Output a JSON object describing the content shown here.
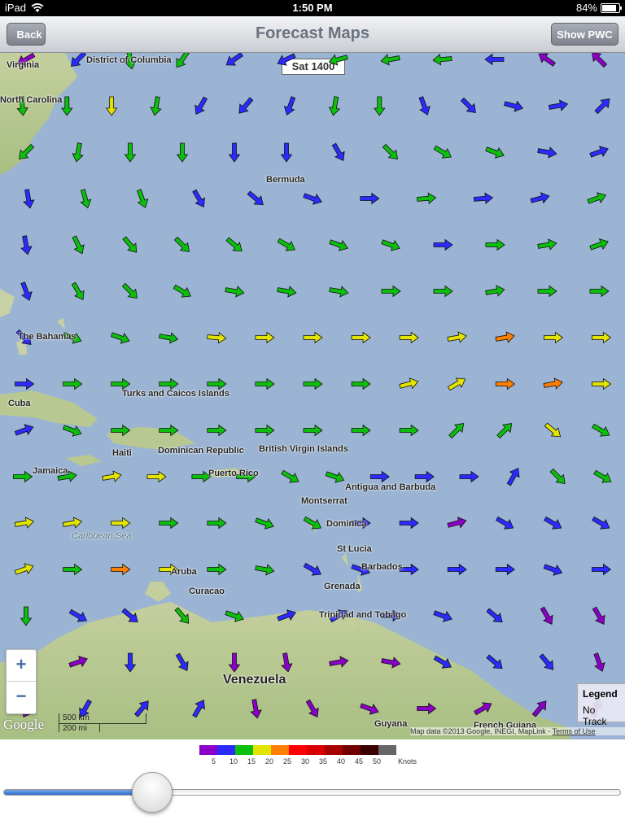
{
  "status_bar": {
    "device": "iPad",
    "time": "1:50 PM",
    "battery": "84%",
    "battery_level": 0.84
  },
  "navbar": {
    "back_label": "Back",
    "title": "Forecast Maps",
    "right_button_label": "Show PWC"
  },
  "map": {
    "time_label": "Sat 1400",
    "places": [
      {
        "id": "virginia",
        "text": "Virginia"
      },
      {
        "id": "dc",
        "text": "District of Columbia"
      },
      {
        "id": "north-carolina",
        "text": "North Carolina"
      },
      {
        "id": "bermuda",
        "text": "Bermuda"
      },
      {
        "id": "bahamas",
        "text": "The Bahamas"
      },
      {
        "id": "cuba",
        "text": "Cuba"
      },
      {
        "id": "turks",
        "text": "Turks and Caicos Islands"
      },
      {
        "id": "haiti",
        "text": "Haiti"
      },
      {
        "id": "dominican",
        "text": "Dominican Republic"
      },
      {
        "id": "bvi",
        "text": "British Virgin Islands"
      },
      {
        "id": "jamaica",
        "text": "Jamaica"
      },
      {
        "id": "puerto-rico",
        "text": "Puerto Rico"
      },
      {
        "id": "antigua",
        "text": "Antigua and Barbuda"
      },
      {
        "id": "montserrat",
        "text": "Montserrat"
      },
      {
        "id": "dominica",
        "text": "Dominica"
      },
      {
        "id": "caribbean",
        "text": "Caribbean Sea"
      },
      {
        "id": "st-lucia",
        "text": "St Lucia"
      },
      {
        "id": "barbados",
        "text": "Barbados"
      },
      {
        "id": "aruba",
        "text": "Aruba"
      },
      {
        "id": "curacao",
        "text": "Curacao"
      },
      {
        "id": "grenada",
        "text": "Grenada"
      },
      {
        "id": "trinidad",
        "text": "Trinidad and Tobago"
      },
      {
        "id": "venezuela",
        "text": "Venezuela"
      },
      {
        "id": "guyana",
        "text": "Guyana"
      },
      {
        "id": "french-guiana",
        "text": "French Guiana"
      }
    ],
    "zoom_in": "+",
    "zoom_out": "−",
    "google_logo": "Google",
    "scale_km": "500 km",
    "scale_mi": "200 mi",
    "copyright": "Map data ©2013 Google, INEGI, MapLink - ",
    "terms_link": "Terms of Use",
    "legend_button": "Legend",
    "track_button": "No Track"
  },
  "wind_colors": {
    "5": "#8a00c8",
    "10": "#2b2bff",
    "15": "#0cbf0c",
    "20": "#e3e300",
    "25": "#ff7f00",
    "30": "#ff0000",
    "35": "#d80000",
    "40": "#a60000",
    "45": "#700000",
    "50": "#3a0000",
    "50+": "#666666"
  },
  "wind_scale": {
    "labels": [
      "5",
      "10",
      "15",
      "20",
      "25",
      "30",
      "35",
      "40",
      "45",
      "50"
    ],
    "unit": "Knots"
  },
  "slider": {
    "value": 0.24
  },
  "wind_grid": [
    [
      "5/150",
      "10/135",
      "15/80",
      "15/125",
      "10/145",
      "10/155",
      "15/165",
      "15/170",
      "15/175",
      "10/180",
      "5/215",
      "5/225"
    ],
    [
      "15/85",
      "15/90",
      "20/90",
      "15/100",
      "10/120",
      "10/130",
      "10/110",
      "15/100",
      "15/90",
      "10/70",
      "10/45",
      "10/15",
      "10/-10",
      "10/-45"
    ],
    [
      "15/135",
      "15/100",
      "15/90",
      "15/90",
      "10/90",
      "10/90",
      "10/60",
      "15/45",
      "15/30",
      "15/20",
      "10/10",
      "10/-20"
    ],
    [
      "10/80",
      "15/75",
      "15/70",
      "10/60",
      "10/40",
      "10/20",
      "10/0",
      "15/-5",
      "10/-5",
      "10/-15",
      "15/-20"
    ],
    [
      "10/80",
      "15/65",
      "15/50",
      "15/45",
      "15/40",
      "15/30",
      "15/20",
      "15/20",
      "10/0",
      "15/0",
      "15/-10",
      "15/-20"
    ],
    [
      "10/70",
      "15/60",
      "15/45",
      "15/30",
      "15/10",
      "15/10",
      "15/10",
      "15/0",
      "15/0",
      "15/-10",
      "15/0",
      "15/0"
    ],
    [
      "10/45",
      "15/20",
      "15/20",
      "15/10",
      "20/5",
      "20/0",
      "20/0",
      "20/0",
      "20/0",
      "20/-10",
      "25/-10",
      "20/0",
      "20/0"
    ],
    [
      "10/0",
      "15/0",
      "15/0",
      "15/0",
      "15/0",
      "15/0",
      "15/0",
      "15/0",
      "20/-15",
      "20/-30",
      "25/0",
      "25/-10",
      "20/0"
    ],
    [
      "10/-20",
      "15/20",
      "15/0",
      "15/0",
      "15/0",
      "15/0",
      "15/0",
      "15/0",
      "15/0",
      "15/-45",
      "15/-45",
      "20/40",
      "15/30"
    ],
    [
      "15/0",
      "15/-10",
      "20/-10",
      "20/0",
      "15/0",
      "15/0",
      "15/30",
      "15/20",
      "10/0",
      "10/0",
      "10/0",
      "10/-60",
      "15/45",
      "15/30"
    ],
    [
      "20/-10",
      "20/-10",
      "20/0",
      "15/0",
      "15/0",
      "15/20",
      "15/30",
      "10/0",
      "10/0",
      "5/-15",
      "10/30",
      "10/30",
      "10/30"
    ],
    [
      "20/-20",
      "15/0",
      "25/0",
      "20/0",
      "15/0",
      "15/10",
      "10/30",
      "10/20",
      "10/0",
      "10/0",
      "10/0",
      "10/20",
      "10/0"
    ],
    [
      "15/90",
      "10/30",
      "10/40",
      "15/50",
      "15/20",
      "10/-20",
      "10/-30",
      "10/0",
      "10/20",
      "10/40",
      "5/60",
      "5/60"
    ],
    [
      "5/110",
      "5/-20",
      "10/90",
      "10/60",
      "5/90",
      "5/80",
      "5/-10",
      "5/10",
      "10/30",
      "10/40",
      "10/50",
      "5/70"
    ],
    [
      "5/120",
      "10/120",
      "10/-50",
      "10/-60",
      "5/80",
      "5/60",
      "5/20",
      "5/0",
      "5/-30",
      "5/-50",
      "5/-70"
    ]
  ]
}
